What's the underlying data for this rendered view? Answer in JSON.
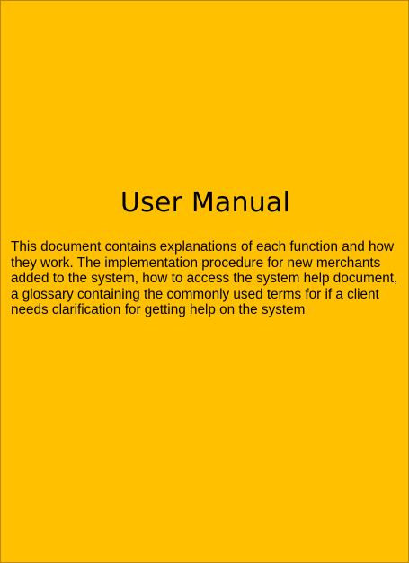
{
  "document": {
    "title": "User Manual",
    "description": "This document contains explanations of each function and how they work. The implementation procedure for new merchants added to the system, how to access the system help document, a glossary containing the commonly used terms for if a client needs clarification for getting help on the system"
  },
  "colors": {
    "background": "#FFC000",
    "text": "#000000"
  }
}
